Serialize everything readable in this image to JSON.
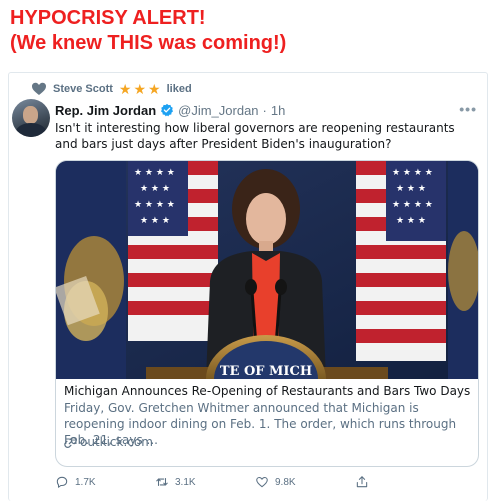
{
  "headline": {
    "line1": "HYPOCRISY ALERT!",
    "line2": "(We knew THIS was coming!)"
  },
  "social_context": {
    "user": "Steve Scott",
    "action": "liked",
    "stars": 3
  },
  "tweet": {
    "author_name": "Rep. Jim Jordan",
    "handle": "@Jim_Jordan",
    "separator": "·",
    "time": "1h",
    "more_label": "•••",
    "text": "Isn't it interesting how liberal governors are reopening restaurants and bars just days after President Biden's inauguration?"
  },
  "link_card": {
    "title": "Michigan Announces Re-Opening of Restaurants and Bars Two Days Aft...",
    "description": "Friday, Gov. Gretchen Whitmer announced that Michigan is reopening indoor dining on Feb. 1. The order, which runs through Feb. 21, says ...",
    "domain": "outkick.com",
    "podium_text": "TE OF MICH"
  },
  "actions": {
    "replies": "1.7K",
    "retweets": "3.1K",
    "likes": "9.8K"
  },
  "colors": {
    "headline": "#ee2020",
    "star": "#f5a623",
    "verified": "#1da1f2",
    "muted": "#5b7083"
  },
  "icons": [
    "heart-icon",
    "star-icon",
    "verified-badge-icon",
    "more-icon",
    "link-icon",
    "reply-icon",
    "retweet-icon",
    "like-icon",
    "share-icon"
  ]
}
